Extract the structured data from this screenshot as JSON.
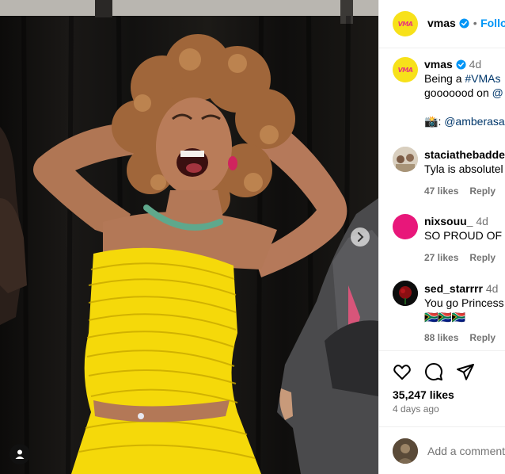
{
  "post": {
    "username": "vmas",
    "avatar_label": "VMA",
    "follow_label": "Follow",
    "separator": "•",
    "caption": {
      "age": "4d",
      "text_prefix": "Being a ",
      "hashtag": "#VMAs",
      "text_tail": " ",
      "line2_prefix": "gooooood on ",
      "line2_mention": "@",
      "camera_emoji": "📸",
      "credit_mention": "@amberasal"
    }
  },
  "comments": [
    {
      "username": "staciathebadde",
      "age": "",
      "text": "Tyla is absolutel",
      "likes": "47 likes",
      "reply": "Reply"
    },
    {
      "username": "nixsouu_",
      "age": "4d",
      "text": "SO PROUD OF U",
      "likes": "27 likes",
      "reply": "Reply"
    },
    {
      "username": "sed_starrrr",
      "age": "4d",
      "text": "You go Princess",
      "text2": "🇿🇦🇿🇦🇿🇦",
      "likes": "88 likes",
      "reply": "Reply"
    }
  ],
  "actions": {
    "likes_count": "35,247 likes",
    "date": "4 days ago"
  },
  "add_comment": {
    "placeholder": "Add a comment"
  },
  "colors": {
    "accent": "#0095f6",
    "vmas_yellow": "#f7e11a",
    "vmas_pink": "#e8357c",
    "dress_yellow": "#f5d90a",
    "comment_avatar_magenta": "#e8177a"
  }
}
